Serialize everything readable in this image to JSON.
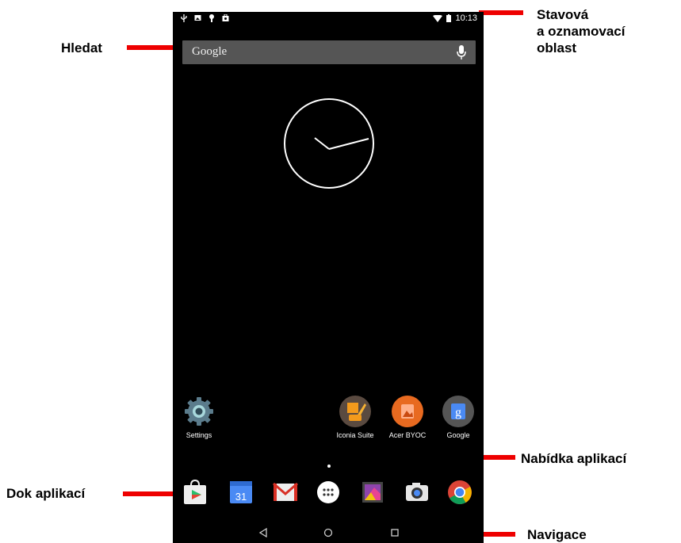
{
  "status_bar": {
    "time": "10:13",
    "left_icons": [
      "usb-icon",
      "image-icon",
      "android-icon",
      "shop-icon"
    ],
    "right_icons": [
      "wifi-icon",
      "battery-icon"
    ]
  },
  "search": {
    "text": "Google"
  },
  "home_apps": [
    {
      "label": "Settings",
      "icon": "settings-icon"
    },
    {
      "label": "Iconia Suite",
      "icon": "iconia-suite-icon"
    },
    {
      "label": "Acer BYOC",
      "icon": "acer-byoc-icon"
    },
    {
      "label": "Google",
      "icon": "google-folder-icon"
    }
  ],
  "dock": {
    "apps": [
      "play-store-icon",
      "calendar-icon",
      "gmail-icon",
      "app-drawer-icon",
      "gallery-icon",
      "camera-icon",
      "chrome-icon"
    ],
    "calendar_day": "31"
  },
  "navigation": [
    "back-icon",
    "home-icon",
    "recents-icon"
  ],
  "annotations": {
    "search": "Hledat",
    "status_line1": "Stavová",
    "status_line2": "a oznamovací",
    "status_line3": "oblast",
    "app_menu": "Nabídka aplikací",
    "dock": "Dok aplikací",
    "navigation": "Navigace"
  },
  "colors": {
    "screen_bg": "#000000",
    "callout": "#ee0000",
    "searchbar": "#555555"
  }
}
